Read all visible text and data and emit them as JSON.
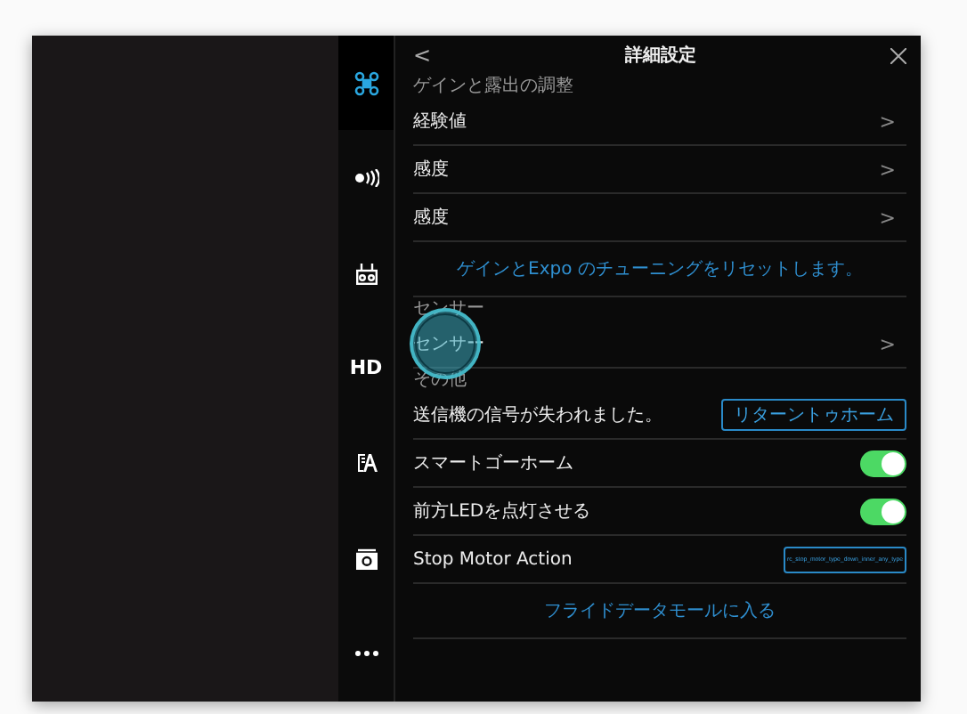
{
  "sidebar": {
    "items": [
      {
        "kind": "drone",
        "selected": true
      },
      {
        "kind": "signal",
        "selected": false
      },
      {
        "kind": "remote",
        "selected": false
      },
      {
        "kind": "text",
        "label": "HD",
        "selected": false
      },
      {
        "kind": "battery",
        "selected": false
      },
      {
        "kind": "camera",
        "selected": false
      },
      {
        "kind": "more",
        "selected": false
      }
    ]
  },
  "header": {
    "back": "<",
    "title": "詳細設定"
  },
  "sections": [
    {
      "label": "ゲインと露出の調整",
      "rows": [
        {
          "kind": "nav",
          "label": "経験値",
          "chevron": ">"
        },
        {
          "kind": "nav",
          "label": "感度",
          "chevron": ">"
        },
        {
          "kind": "nav",
          "label": "感度",
          "chevron": ">"
        },
        {
          "kind": "link",
          "label": "ゲインとExpo のチューニングをリセットします。"
        }
      ]
    },
    {
      "label": "センサー",
      "rows": [
        {
          "kind": "nav",
          "label": "センサー",
          "chevron": ">",
          "touched": true
        }
      ]
    },
    {
      "label": "その他",
      "rows": [
        {
          "kind": "button",
          "label": "送信機の信号が失われました。",
          "button": "リターントゥホーム"
        },
        {
          "kind": "toggle",
          "label": "スマートゴーホーム",
          "on": true
        },
        {
          "kind": "toggle",
          "label": "前方LEDを点灯させる",
          "on": true
        },
        {
          "kind": "select",
          "label": "Stop Motor Action",
          "value": "rc_stop_motor_type_down_inner_any_type"
        },
        {
          "kind": "link",
          "label": "フライドデータモールに入る"
        }
      ]
    }
  ]
}
